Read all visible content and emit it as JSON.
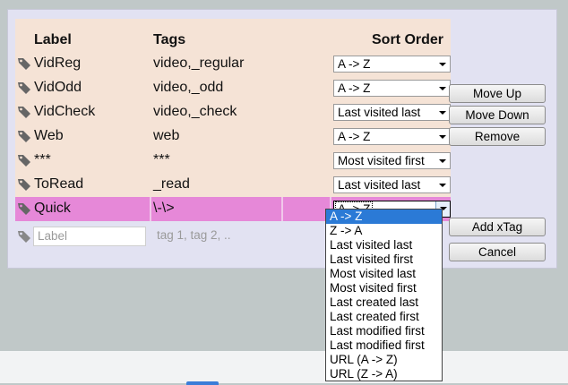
{
  "columns": {
    "label": "Label",
    "tags": "Tags",
    "sort_order": "Sort Order"
  },
  "rows": [
    {
      "label": "VidReg",
      "tags": "video,_regular",
      "sort": "A -> Z"
    },
    {
      "label": "VidOdd",
      "tags": "video,_odd",
      "sort": "A -> Z"
    },
    {
      "label": "VidCheck",
      "tags": "video,_check",
      "sort": "Last visited last"
    },
    {
      "label": "Web",
      "tags": "web",
      "sort": "A -> Z"
    },
    {
      "label": "***",
      "tags": "***",
      "sort": "Most visited first"
    },
    {
      "label": "ToRead",
      "tags": "_read",
      "sort": "Last visited last"
    },
    {
      "label": "Quick",
      "tags": "\\-\\>",
      "sort": "A -> Z"
    }
  ],
  "new_row": {
    "label_placeholder": "Label",
    "tags_placeholder": "tag 1, tag 2, .."
  },
  "buttons": {
    "move_up": "Move Up",
    "move_down": "Move Down",
    "remove": "Remove",
    "add": "Add xTag",
    "cancel": "Cancel"
  },
  "dropdown_options": [
    "A -> Z",
    "Z -> A",
    "Last visited last",
    "Last visited first",
    "Most visited last",
    "Most visited first",
    "Last created last",
    "Last created first",
    "Last modified first",
    "Last modified first",
    "URL (A -> Z)",
    "URL (Z -> A)"
  ],
  "dropdown_selected_index": 0,
  "colors": {
    "table_bg": "#f5e3d6",
    "selected_row": "#e688d8",
    "highlight": "#2b7ad6",
    "dialog_bg": "#e2e2f2"
  }
}
